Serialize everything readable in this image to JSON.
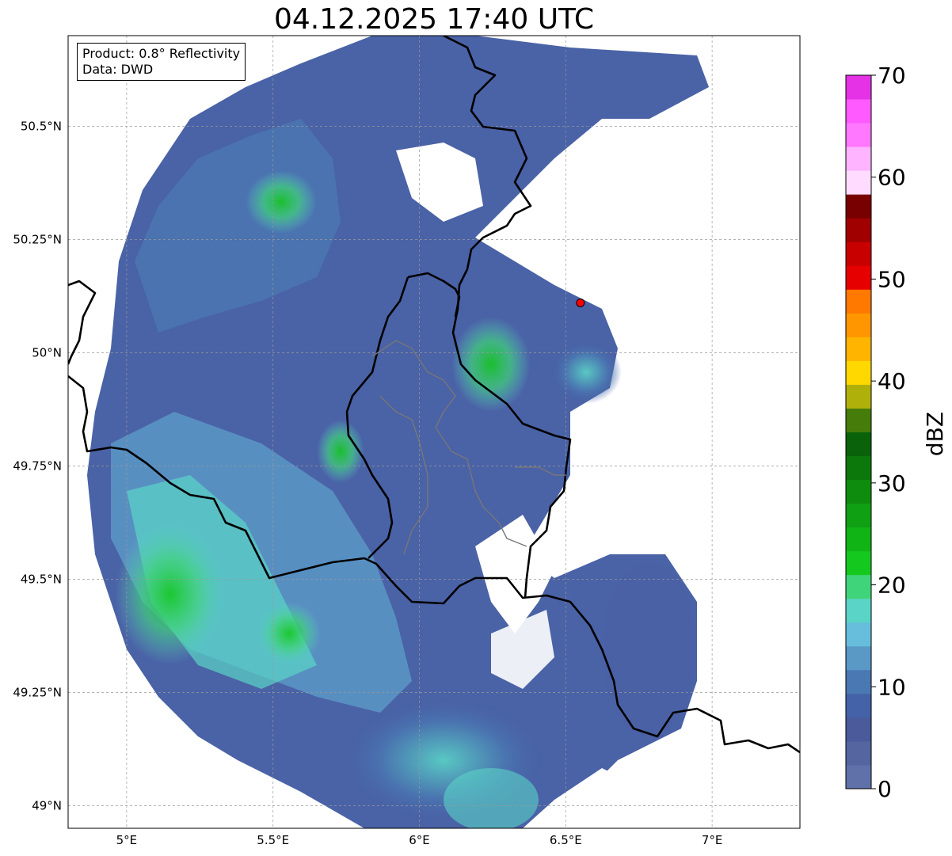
{
  "title": "04.12.2025 17:40 UTC",
  "info": {
    "product": "Product: 0.8° Reflectivity",
    "data": "Data: DWD"
  },
  "map": {
    "lon_range": [
      4.8,
      7.3
    ],
    "lat_range": [
      48.95,
      50.7
    ],
    "x_ticks": [
      {
        "lon": 5.0,
        "label": "5°E"
      },
      {
        "lon": 5.5,
        "label": "5.5°E"
      },
      {
        "lon": 6.0,
        "label": "6°E"
      },
      {
        "lon": 6.5,
        "label": "6.5°E"
      },
      {
        "lon": 7.0,
        "label": "7°E"
      }
    ],
    "y_ticks": [
      {
        "lat": 49.0,
        "label": "49°N"
      },
      {
        "lat": 49.25,
        "label": "49.25°N"
      },
      {
        "lat": 49.5,
        "label": "49.5°N"
      },
      {
        "lat": 49.75,
        "label": "49.75°N"
      },
      {
        "lat": 50.0,
        "label": "50°N"
      },
      {
        "lat": 50.25,
        "label": "50.25°N"
      },
      {
        "lat": 50.5,
        "label": "50.5°N"
      }
    ],
    "radar_site": {
      "lon": 6.55,
      "lat": 50.11,
      "color": "#ff0000"
    }
  },
  "colorbar": {
    "label": "dBZ",
    "min": 0,
    "max": 70,
    "tick_labels": [
      "0",
      "10",
      "20",
      "30",
      "40",
      "50",
      "60",
      "70"
    ],
    "colors": [
      "#6070a8",
      "#5565a0",
      "#4a5a9a",
      "#4462a8",
      "#4a78b2",
      "#5a98c6",
      "#66bedc",
      "#5ad4c6",
      "#40d47a",
      "#14c81e",
      "#10b414",
      "#10a014",
      "#0e8c0e",
      "#0c780c",
      "#0a620a",
      "#467c0a",
      "#b0b00a",
      "#ffd800",
      "#ffb400",
      "#ff9600",
      "#ff7800",
      "#e60000",
      "#c80000",
      "#a00000",
      "#780000",
      "#ffdcff",
      "#ffb4ff",
      "#ff78ff",
      "#ff5aff",
      "#e632e6"
    ]
  }
}
